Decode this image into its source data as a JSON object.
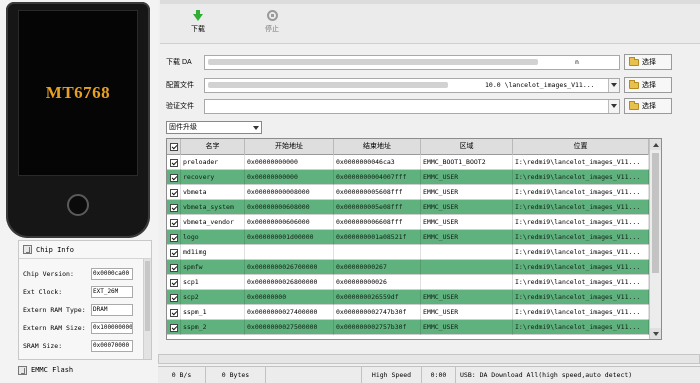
{
  "device": {
    "chip_model": "MT6768"
  },
  "chip_info": {
    "title": "Chip Info",
    "fields": [
      {
        "label": "Chip Version:",
        "value": "0x0000ca00"
      },
      {
        "label": "Ext Clock:",
        "value": "EXT_26M"
      },
      {
        "label": "Extern RAM Type:",
        "value": "DRAM"
      },
      {
        "label": "Extern RAM Size:",
        "value": "0x100000000"
      },
      {
        "label": "SRAM Size:",
        "value": "0x00070000"
      }
    ],
    "footer": "EMMC Flash"
  },
  "toolbar": {
    "download_label": "下载",
    "stop_label": "停止"
  },
  "paths": {
    "download_agent": {
      "label": "下载 DA",
      "value_tail": "n"
    },
    "scatter_file": {
      "label": "配置文件",
      "value_tail": "10.0 \\lancelot_images_V11..."
    },
    "auth_file": {
      "label": "验证文件",
      "value_tail": ""
    },
    "choose_label": "选择"
  },
  "mode_select": {
    "value": "固件升级"
  },
  "table": {
    "headers": {
      "name": "名字",
      "start": "开始地址",
      "end": "结束地址",
      "region": "区域",
      "location": "位置"
    },
    "rows": [
      {
        "checked": true,
        "name": "preloader",
        "start": "0x00000000000",
        "end": "0x0000000046ca3",
        "region": "EMMC_BOOT1_BOOT2",
        "location": "I:\\redmi9\\lancelot_images_V11...",
        "green": false
      },
      {
        "checked": true,
        "name": "recovery",
        "start": "0x00000000000",
        "end": "0x0000000004007fff",
        "region": "EMMC_USER",
        "location": "I:\\redmi9\\lancelot_images_V11...",
        "green": true
      },
      {
        "checked": true,
        "name": "vbmeta",
        "start": "0x00000000008000",
        "end": "0x000000005608fff",
        "region": "EMMC_USER",
        "location": "I:\\redmi9\\lancelot_images_V11...",
        "green": false
      },
      {
        "checked": true,
        "name": "vbmeta_system",
        "start": "0x00000000608000",
        "end": "0x000000005e08fff",
        "region": "EMMC_USER",
        "location": "I:\\redmi9\\lancelot_images_V11...",
        "green": true
      },
      {
        "checked": true,
        "name": "vbmeta_vendor",
        "start": "0x00000000606000",
        "end": "0x000000006608fff",
        "region": "EMMC_USER",
        "location": "I:\\redmi9\\lancelot_images_V11...",
        "green": false
      },
      {
        "checked": true,
        "name": "logo",
        "start": "0x000000001d00000",
        "end": "0x000000001a08521f",
        "region": "EMMC_USER",
        "location": "I:\\redmi9\\lancelot_images_V11...",
        "green": true
      },
      {
        "checked": true,
        "name": "md1img",
        "start": "",
        "end": "",
        "region": "",
        "location": "I:\\redmi9\\lancelot_images_V11...",
        "green": false
      },
      {
        "checked": true,
        "name": "spmfw",
        "start": "0x0000000026700000",
        "end": "0x00000000267",
        "region": "",
        "location": "I:\\redmi9\\lancelot_images_V11...",
        "green": true
      },
      {
        "checked": true,
        "name": "scp1",
        "start": "0x0000000026800000",
        "end": "0x00000000026",
        "region": "",
        "location": "I:\\redmi9\\lancelot_images_V11...",
        "green": false
      },
      {
        "checked": true,
        "name": "scp2",
        "start": "0x00000000",
        "end": "0x000000026559df",
        "region": "EMMC_USER",
        "location": "I:\\redmi9\\lancelot_images_V11...",
        "green": true
      },
      {
        "checked": true,
        "name": "sspm_1",
        "start": "0x0000000027400000",
        "end": "0x000000002747b30f",
        "region": "EMMC_USER",
        "location": "I:\\redmi9\\lancelot_images_V11...",
        "green": false
      },
      {
        "checked": true,
        "name": "sspm_2",
        "start": "0x0000000027500000",
        "end": "0x000000002757b30f",
        "region": "EMMC_USER",
        "location": "I:\\redmi9\\lancelot_images_V11...",
        "green": true
      }
    ]
  },
  "status": {
    "speed": "0 B/s",
    "bytes": "0 Bytes",
    "empty_cell": "",
    "usb_speed": "High Speed",
    "time": "0:00",
    "message": "USB: DA Download All(high speed,auto detect)",
    "progress_percent": 0
  },
  "colors": {
    "row_highlight": "#5fb27d",
    "chip_model_text": "#e7a021"
  }
}
